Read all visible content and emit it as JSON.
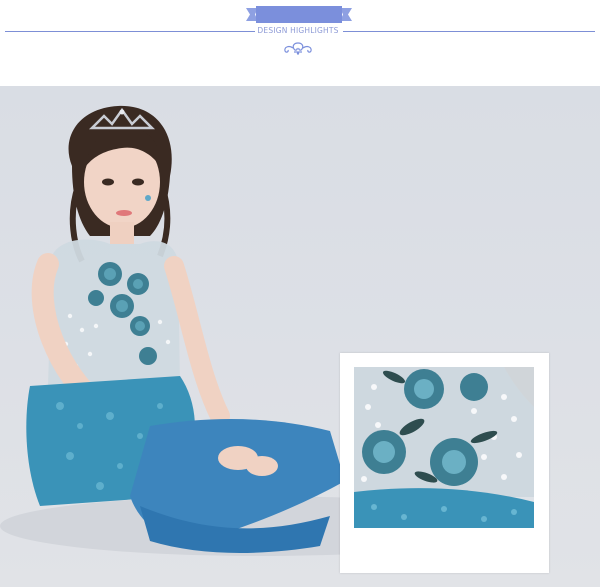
{
  "header": {
    "subtitle": "DESIGN HIGHLIGHTS",
    "accent_color": "#7b8fdc",
    "ornament_icon": "flourish-ornament-icon"
  },
  "photo": {
    "alt": "",
    "inset_alt": ""
  },
  "colors": {
    "background": "#dcdfe5",
    "dress_blue": "#3a93b8",
    "embroidery": "#3e7f93"
  }
}
